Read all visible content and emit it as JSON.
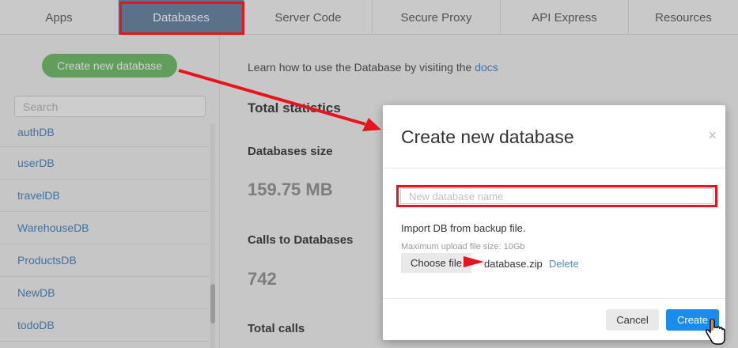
{
  "tabs": [
    {
      "label": "Apps",
      "active": false
    },
    {
      "label": "Databases",
      "active": true
    },
    {
      "label": "Server Code",
      "active": false
    },
    {
      "label": "Secure Proxy",
      "active": false
    },
    {
      "label": "API Express",
      "active": false
    },
    {
      "label": "Resources",
      "active": false
    }
  ],
  "sidebar": {
    "create_button": "Create new database",
    "search_placeholder": "Search",
    "databases": [
      "authDB",
      "userDB",
      "travelDB",
      "WarehouseDB",
      "ProductsDB",
      "NewDB",
      "todoDB"
    ]
  },
  "main": {
    "learn_text": "Learn how to use the Database by visiting the ",
    "learn_link": "docs",
    "total_statistics": "Total statistics",
    "databases_size_label": "Databases size",
    "databases_size_value": "159.75 MB",
    "calls_label": "Calls to Databases",
    "calls_value": "742",
    "total_calls_label": "Total calls"
  },
  "modal": {
    "title": "Create new database",
    "close": "×",
    "name_placeholder": "New database name",
    "import_label": "Import DB from backup file.",
    "max_size": "Maximum upload file size: 10Gb",
    "choose_file": "Choose file",
    "filename": "database.zip",
    "delete": "Delete",
    "cancel": "Cancel",
    "create": "Create"
  },
  "colors": {
    "annotation_red": "#e8141d",
    "active_tab": "#6e8ca8",
    "create_green": "#78c070",
    "primary_blue": "#1a8cf0",
    "link_blue": "#4f8bc6"
  }
}
